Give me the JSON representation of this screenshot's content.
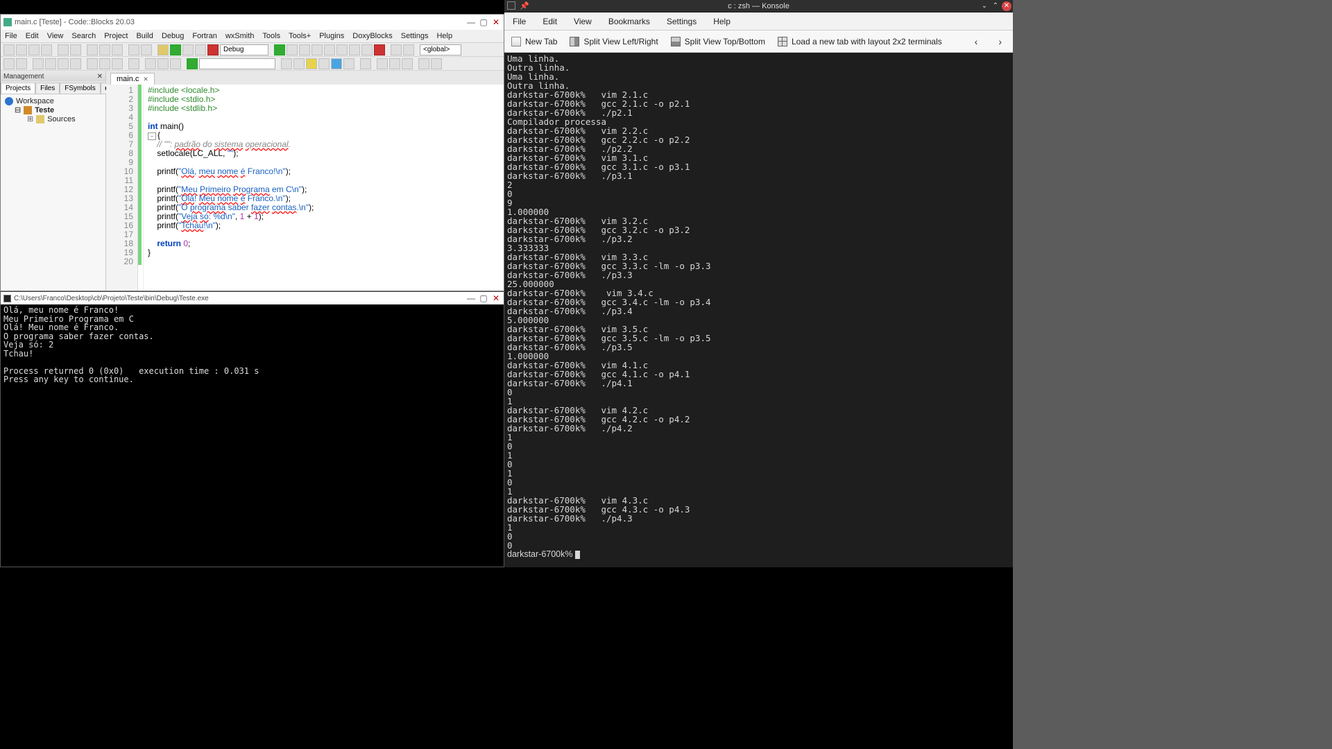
{
  "cb": {
    "title": "main.c [Teste] - Code::Blocks 20.03",
    "menu": [
      "File",
      "Edit",
      "View",
      "Search",
      "Project",
      "Build",
      "Debug",
      "Fortran",
      "wxSmith",
      "Tools",
      "Tools+",
      "Plugins",
      "DoxyBlocks",
      "Settings",
      "Help"
    ],
    "config": "Debug",
    "scope": "<global>",
    "side_head": "Management",
    "side_tabs": [
      "Projects",
      "Files",
      "FSymbols"
    ],
    "tree": {
      "workspace": "Workspace",
      "project": "Teste",
      "folder": "Sources"
    },
    "ed_tab": "main.c",
    "code_lines": [
      {
        "n": 1,
        "html": "<span class='pp'>#include &lt;locale.h&gt;</span>"
      },
      {
        "n": 2,
        "html": "<span class='pp'>#include &lt;stdio.h&gt;</span>"
      },
      {
        "n": 3,
        "html": "<span class='pp'>#include &lt;stdlib.h&gt;</span>"
      },
      {
        "n": 4,
        "html": ""
      },
      {
        "n": 5,
        "html": "<span class='kw'>int</span> <span class='fn'>main</span>()"
      },
      {
        "n": 6,
        "html": "{"
      },
      {
        "n": 7,
        "html": "    <span class='cm'>// \"\": <span class='un'>padrão</span> do <span class='un'>sistema</span> <span class='un'>operacional</span>.</span>"
      },
      {
        "n": 8,
        "html": "    setlocale(LC_ALL, <span class='st'>\"\"</span>);"
      },
      {
        "n": 9,
        "html": ""
      },
      {
        "n": 10,
        "html": "    printf(<span class='st'>\"<span class='un'>Olá</span>, <span class='un'>meu</span> <span class='un'>nome</span> <span class='un'>é</span> Franco!\\n\"</span>);"
      },
      {
        "n": 11,
        "html": ""
      },
      {
        "n": 12,
        "html": "    printf(<span class='st'>\"<span class='un'>Meu</span> <span class='un'>Primeiro</span> <span class='un'>Programa</span> em C\\n\"</span>);"
      },
      {
        "n": 13,
        "html": "    printf(<span class='st'>\"<span class='un'>Olá</span>! <span class='un'>Meu</span> <span class='un'>nome</span> <span class='un'>é</span> Franco.\\n\"</span>);"
      },
      {
        "n": 14,
        "html": "    printf(<span class='st'>\"O <span class='un'>programa</span> saber <span class='un'>fazer</span> <span class='un'>contas</span>.\\n\"</span>);"
      },
      {
        "n": 15,
        "html": "    printf(<span class='st'>\"<span class='un'>Veja</span> <span class='un'>só</span>: %d\\n\"</span>, <span class='nu'>1</span> + <span class='nu'>1</span>);"
      },
      {
        "n": 16,
        "html": "    printf(<span class='st'>\"<span class='un'>Tchau</span>!\\n\"</span>);"
      },
      {
        "n": 17,
        "html": ""
      },
      {
        "n": 18,
        "html": "    <span class='kw'>return</span> <span class='nu'>0</span>;"
      },
      {
        "n": 19,
        "html": "}"
      },
      {
        "n": 20,
        "html": ""
      }
    ]
  },
  "console": {
    "title": "C:\\Users\\Franco\\Desktop\\cb\\Projeto\\Teste\\bin\\Debug\\Teste.exe",
    "lines": [
      "Olá, meu nome é Franco!",
      "Meu Primeiro Programa em C",
      "Olá! Meu nome é Franco.",
      "O programa saber fazer contas.",
      "Veja só: 2",
      "Tchau!",
      "",
      "Process returned 0 (0x0)   execution time : 0.031 s",
      "Press any key to continue."
    ]
  },
  "kon": {
    "title": "c : zsh — Konsole",
    "menu": [
      "File",
      "Edit",
      "View",
      "Bookmarks",
      "Settings",
      "Help"
    ],
    "tb": {
      "newtab": "New Tab",
      "splitlr": "Split View Left/Right",
      "splittb": "Split View Top/Bottom",
      "layout": "Load a new tab with layout 2x2 terminals"
    },
    "prompt": "darkstar-6700k%",
    "lines": [
      "Uma linha.",
      "Outra linha.",
      "Uma linha.",
      "Outra linha.",
      "darkstar-6700k%   vim 2.1.c",
      "darkstar-6700k%   gcc 2.1.c -o p2.1",
      "darkstar-6700k%   ./p2.1",
      "Compilador processa",
      "darkstar-6700k%   vim 2.2.c",
      "darkstar-6700k%   gcc 2.2.c -o p2.2",
      "darkstar-6700k%   ./p2.2",
      "darkstar-6700k%   vim 3.1.c",
      "darkstar-6700k%   gcc 3.1.c -o p3.1",
      "darkstar-6700k%   ./p3.1",
      "2",
      "0",
      "9",
      "1.000000",
      "darkstar-6700k%   vim 3.2.c",
      "darkstar-6700k%   gcc 3.2.c -o p3.2",
      "darkstar-6700k%   ./p3.2",
      "3.333333",
      "darkstar-6700k%   vim 3.3.c",
      "darkstar-6700k%   gcc 3.3.c -lm -o p3.3",
      "darkstar-6700k%   ./p3.3",
      "25.000000",
      "darkstar-6700k%    vim 3.4.c",
      "darkstar-6700k%   gcc 3.4.c -lm -o p3.4",
      "darkstar-6700k%   ./p3.4",
      "5.000000",
      "darkstar-6700k%   vim 3.5.c",
      "darkstar-6700k%   gcc 3.5.c -lm -o p3.5",
      "darkstar-6700k%   ./p3.5",
      "1.000000",
      "darkstar-6700k%   vim 4.1.c",
      "darkstar-6700k%   gcc 4.1.c -o p4.1",
      "darkstar-6700k%   ./p4.1",
      "0",
      "1",
      "darkstar-6700k%   vim 4.2.c",
      "darkstar-6700k%   gcc 4.2.c -o p4.2",
      "darkstar-6700k%   ./p4.2",
      "1",
      "0",
      "1",
      "0",
      "1",
      "0",
      "1",
      "darkstar-6700k%   vim 4.3.c",
      "darkstar-6700k%   gcc 4.3.c -o p4.3",
      "darkstar-6700k%   ./p4.3",
      "1",
      "0",
      "0",
      ""
    ]
  }
}
